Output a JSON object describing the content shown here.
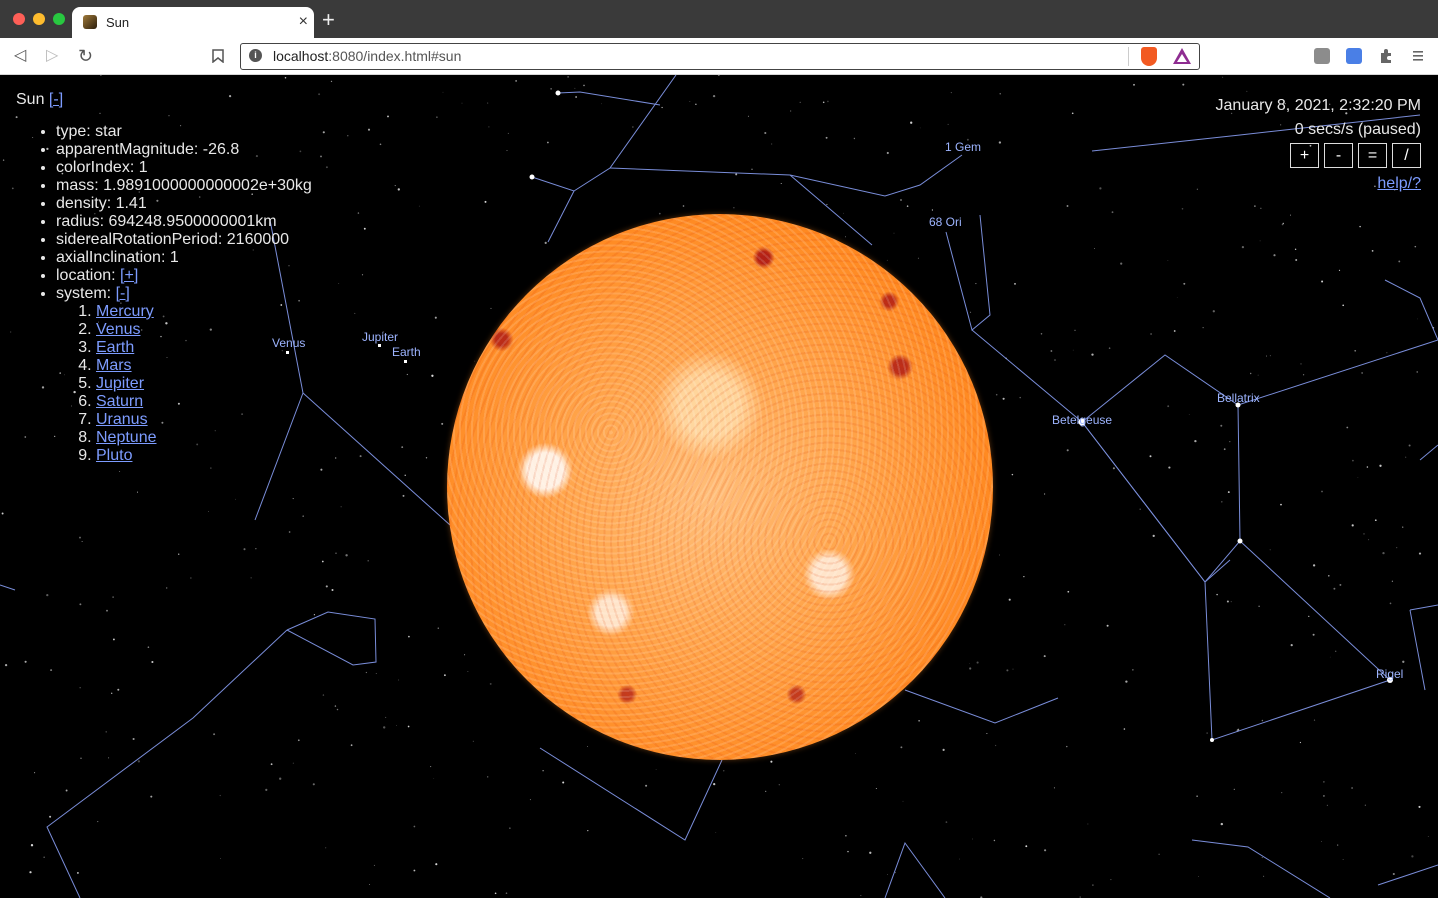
{
  "window": {
    "colors": {
      "close": "#fe5f57",
      "minimize": "#febc2e",
      "zoom": "#28c840"
    }
  },
  "tab": {
    "title": "Sun",
    "close_glyph": "×"
  },
  "new_tab_glyph": "+",
  "toolbar": {
    "back_glyph": "◁",
    "forward_glyph": "▷",
    "reload_glyph": "↻",
    "bookmark_glyph": "🔖"
  },
  "url": {
    "host": "localhost",
    "rest": ":8080/index.html#sun"
  },
  "page": {
    "title": "Sun",
    "title_toggle": "[-]",
    "properties": [
      "type: star",
      "apparentMagnitude: -26.8",
      "colorIndex: 1",
      "mass: 1.9891000000000002e+30kg",
      "density: 1.41",
      "radius: 694248.9500000001km",
      "siderealRotationPeriod: 2160000",
      "axialInclination: 1"
    ],
    "location_label": "location: ",
    "location_toggle": "[+]",
    "system_label": "system: ",
    "system_toggle": "[-]",
    "system_items": [
      "Mercury",
      "Venus",
      "Earth",
      "Mars",
      "Jupiter",
      "Saturn",
      "Uranus",
      "Neptune",
      "Pluto"
    ]
  },
  "clock": {
    "date": "January 8, 2021, 2:32:20 PM",
    "rate": "0 secs/s (paused)"
  },
  "controls": [
    "+",
    "-",
    "=",
    "/"
  ],
  "help_link": "help/?",
  "labels": {
    "venus": "Venus",
    "jupiter": "Jupiter",
    "earth": "Earth",
    "gem": "1 Gem",
    "ori": "68 Ori",
    "betelgeuse": "Betelgeuse",
    "bellatrix": "Bellatrix",
    "rigel": "Rigel"
  }
}
